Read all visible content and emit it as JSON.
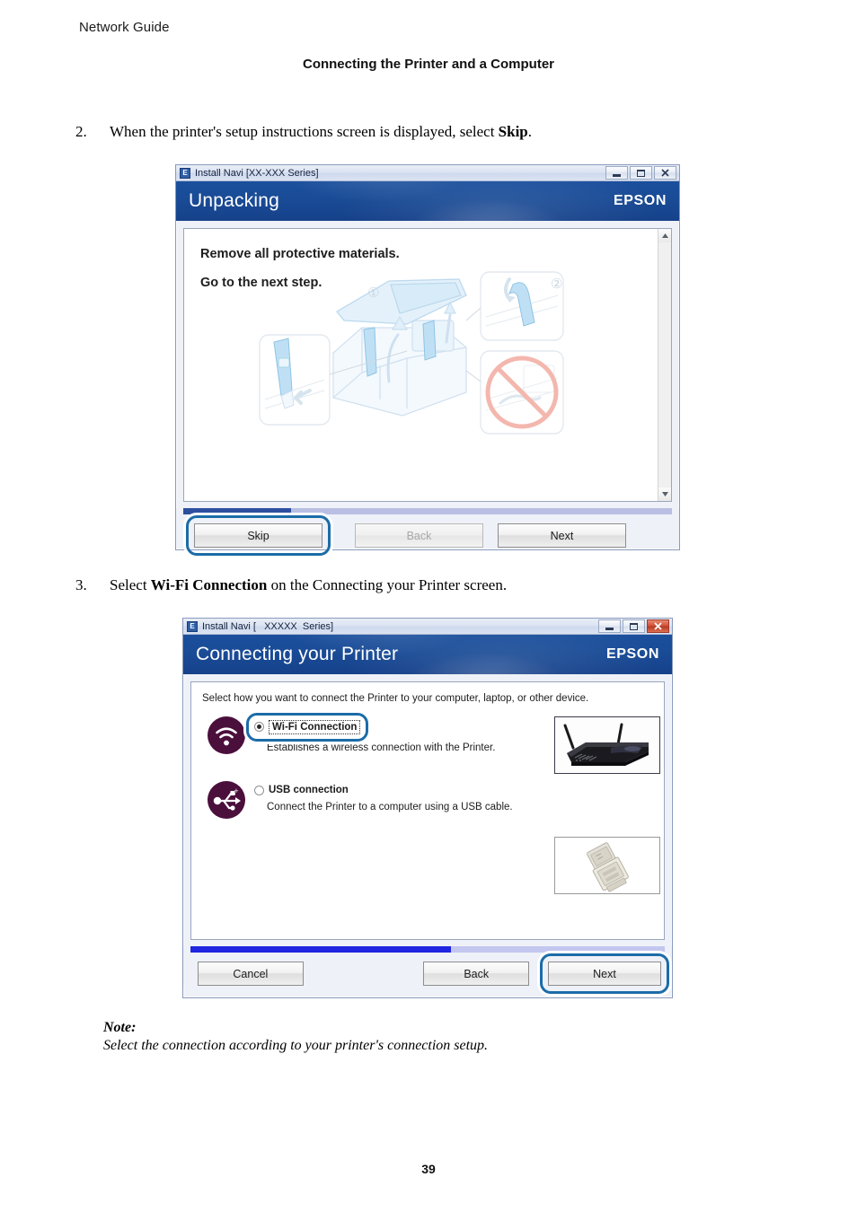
{
  "document": {
    "header_left": "Network Guide",
    "header_center": "Connecting the Printer and a Computer",
    "page_number": "39"
  },
  "steps": [
    {
      "number": "2.",
      "text_before": "When the printer's setup instructions screen is displayed, select ",
      "bold": "Skip",
      "text_after": "."
    },
    {
      "number": "3.",
      "text_before": "Select ",
      "bold": "Wi-Fi Connection",
      "text_after": " on the Connecting your Printer screen."
    }
  ],
  "note": {
    "title": "Note:",
    "text": "Select the connection according to your printer's connection setup."
  },
  "dialog1": {
    "titlebar": {
      "app_icon_label": "E",
      "title": "Install Navi [XX-XXX Series]",
      "minimize_label": "—",
      "maximize_label": "□",
      "close_label": "✕"
    },
    "banner": {
      "title": "Unpacking",
      "brand": "EPSON"
    },
    "body": {
      "line1": "Remove all protective materials.",
      "line2": "Go to the next step.",
      "illustration": {
        "callout_1": "①",
        "callout_2": "②",
        "prohibition": "no-hands-symbol"
      },
      "scroll_up": "▲",
      "scroll_down": "▼"
    },
    "progress": {
      "percent": 22,
      "fill_color": "#2e4fa0",
      "track_color": "#b9bfe2"
    },
    "buttons": {
      "skip": "Skip",
      "back": "Back",
      "next": "Next",
      "back_disabled": true,
      "highlighted": "Skip"
    }
  },
  "dialog2": {
    "titlebar": {
      "app_icon_label": "E",
      "title": "Install Navi [   XXXXX  Series]",
      "minimize_label": "—",
      "maximize_label": "□",
      "close_label": "✕",
      "close_color": "#c0452c"
    },
    "banner": {
      "title": "Connecting your Printer",
      "brand": "EPSON"
    },
    "body": {
      "intro": "Select how you want to connect the Printer to your computer, laptop, or other device.",
      "options": [
        {
          "icon": "wifi-icon",
          "icon_color": "#4b0f3c",
          "label": "Wi-Fi Connection",
          "description": "Establishes a wireless connection with the Printer.",
          "selected": true,
          "focused": true,
          "highlighted": true,
          "thumbnail": "wireless-router-photo"
        },
        {
          "icon": "usb-icon",
          "icon_color": "#4b0f3c",
          "label": "USB connection",
          "description": "Connect the Printer to a computer using a USB cable.",
          "selected": false,
          "focused": false,
          "highlighted": false,
          "thumbnail": "usb-connector-photo"
        }
      ]
    },
    "progress": {
      "percent": 55,
      "fill_color": "#1f25e0",
      "track_color": "#c3c6ee"
    },
    "buttons": {
      "cancel": "Cancel",
      "back": "Back",
      "next": "Next",
      "highlighted": "Next"
    }
  }
}
